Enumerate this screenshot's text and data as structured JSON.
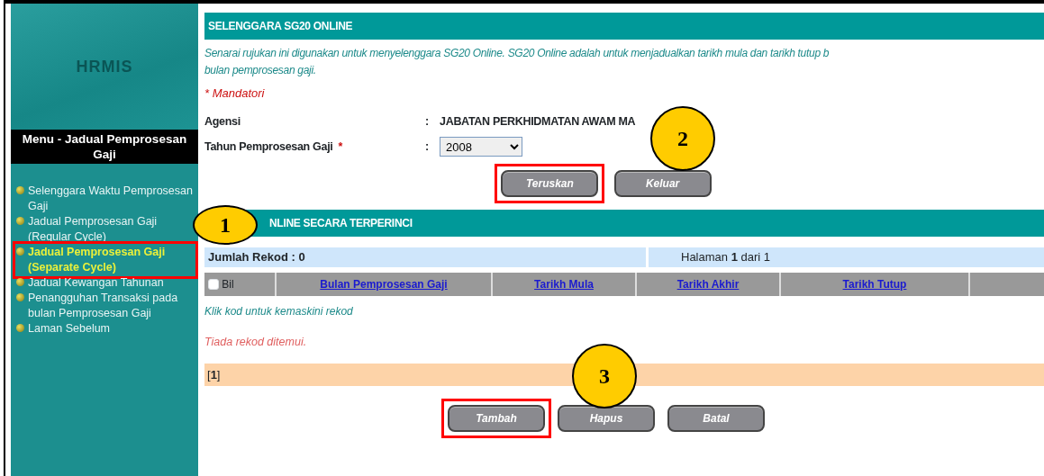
{
  "sidebar": {
    "logo_text": "HRMIS",
    "menu_title": "Menu - Jadual Pemprosesan Gaji",
    "items": [
      {
        "label": "Selenggara Waktu Pemprosesan Gaji",
        "selected": false,
        "highlighted": false
      },
      {
        "label": "Jadual Pemprosesan Gaji (Regular Cycle)",
        "selected": false,
        "highlighted": false
      },
      {
        "label": "Jadual Pemprosesan Gaji (Separate Cycle)",
        "selected": true,
        "highlighted": true
      },
      {
        "label": "Jadual Kewangan Tahunan",
        "selected": false,
        "highlighted": false
      },
      {
        "label": "Penangguhan Transaksi pada bulan Pemprosesan Gaji",
        "selected": false,
        "highlighted": false
      },
      {
        "label": "Laman Sebelum",
        "selected": false,
        "highlighted": false
      }
    ]
  },
  "main": {
    "title": "SELENGGARA SG20 ONLINE",
    "description": [
      "Senarai rujukan ini digunakan untuk menyelenggara SG20 Online. SG20 Online adalah untuk menjadualkan tarikh mula dan tarikh tutup b",
      "bulan pemprosesan gaji."
    ],
    "mandatory_note": "* Mandatori",
    "fields": [
      {
        "label": "Agensi",
        "kind": "text",
        "value": "JABATAN PERKHIDMATAN AWAM MA"
      },
      {
        "label": "Tahun Pemprosesan Gaji",
        "required_mark": "*",
        "kind": "select",
        "value": "2008"
      }
    ],
    "separator": ":",
    "form_buttons": [
      {
        "label": "Teruskan",
        "highlighted": true
      },
      {
        "label": "Keluar",
        "highlighted": false
      }
    ],
    "detail_title": "NLINE SECARA TERPERINCI",
    "record_count": "Jumlah Rekod : 0",
    "pagination": "Halaman **1** dari 1",
    "table": {
      "select_all": {
        "checked": false
      },
      "columns": [
        "Bil",
        "Bulan Pemprosesan Gaji",
        "Tarikh Mula",
        "Tarikh Akhir",
        "Tarikh Tutup"
      ]
    },
    "hint": "Klik kod untuk kemaskini rekod",
    "empty_message": "Tiada rekod ditemui.",
    "pager": "[**1**]",
    "action_buttons": [
      {
        "label": "Tambah",
        "highlighted": true
      },
      {
        "label": "Hapus",
        "highlighted": false
      },
      {
        "label": "Batal",
        "highlighted": false
      }
    ]
  },
  "callouts": [
    {
      "label": "1"
    },
    {
      "label": "2"
    },
    {
      "label": "3"
    }
  ]
}
